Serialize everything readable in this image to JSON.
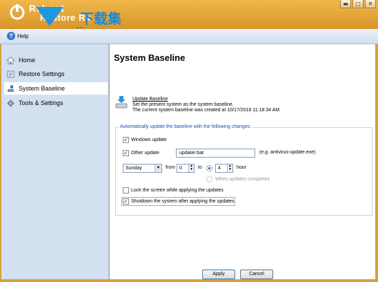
{
  "app": {
    "name_line1": "Reboot",
    "name_line2": "Restore Rx",
    "watermark": "xzji.com",
    "watermark_cn": "下载集"
  },
  "window_controls": [
    "minimize-icon",
    "maximize-icon",
    "close-icon"
  ],
  "menu": {
    "help_label": "Help"
  },
  "sidebar": {
    "items": [
      {
        "label": "Home",
        "icon": "home-icon"
      },
      {
        "label": "Restore Settings",
        "icon": "restore-icon"
      },
      {
        "label": "System Baseline",
        "icon": "baseline-icon",
        "active": true
      },
      {
        "label": "Tools & Settings",
        "icon": "tools-icon"
      }
    ]
  },
  "main": {
    "title": "System Baseline",
    "update": {
      "heading": "Update Baseline",
      "desc": "Set the present system as the system baseline.",
      "created": "The current system baseline was created at 10/17/2016 11:18:34 AM"
    },
    "group": {
      "title": "Automatically update the baseline with the following changes:",
      "windows_update": {
        "label": "Windows update",
        "checked": true
      },
      "other_update": {
        "label": "Other update",
        "checked": true,
        "value": "updater.bat",
        "hint": "(e.g. antivirus-update.exe)"
      },
      "schedule": {
        "day": "Sunday",
        "from_label": "from",
        "from_value": "0",
        "to_label": "to",
        "to_value": "4",
        "unit": "hour",
        "when_complete": "When updates completes"
      },
      "lock_screen": {
        "label": "Lock the screen while applying the updates",
        "checked": false
      },
      "shutdown": {
        "label": "Shutdown the system after applying the updates",
        "checked": true
      }
    },
    "buttons": {
      "apply": "Apply",
      "cancel": "Cancel"
    }
  },
  "colors": {
    "titlebar": "#e0a23a",
    "sidebar": "#d3e0f0",
    "group_title": "#1a4db3"
  }
}
